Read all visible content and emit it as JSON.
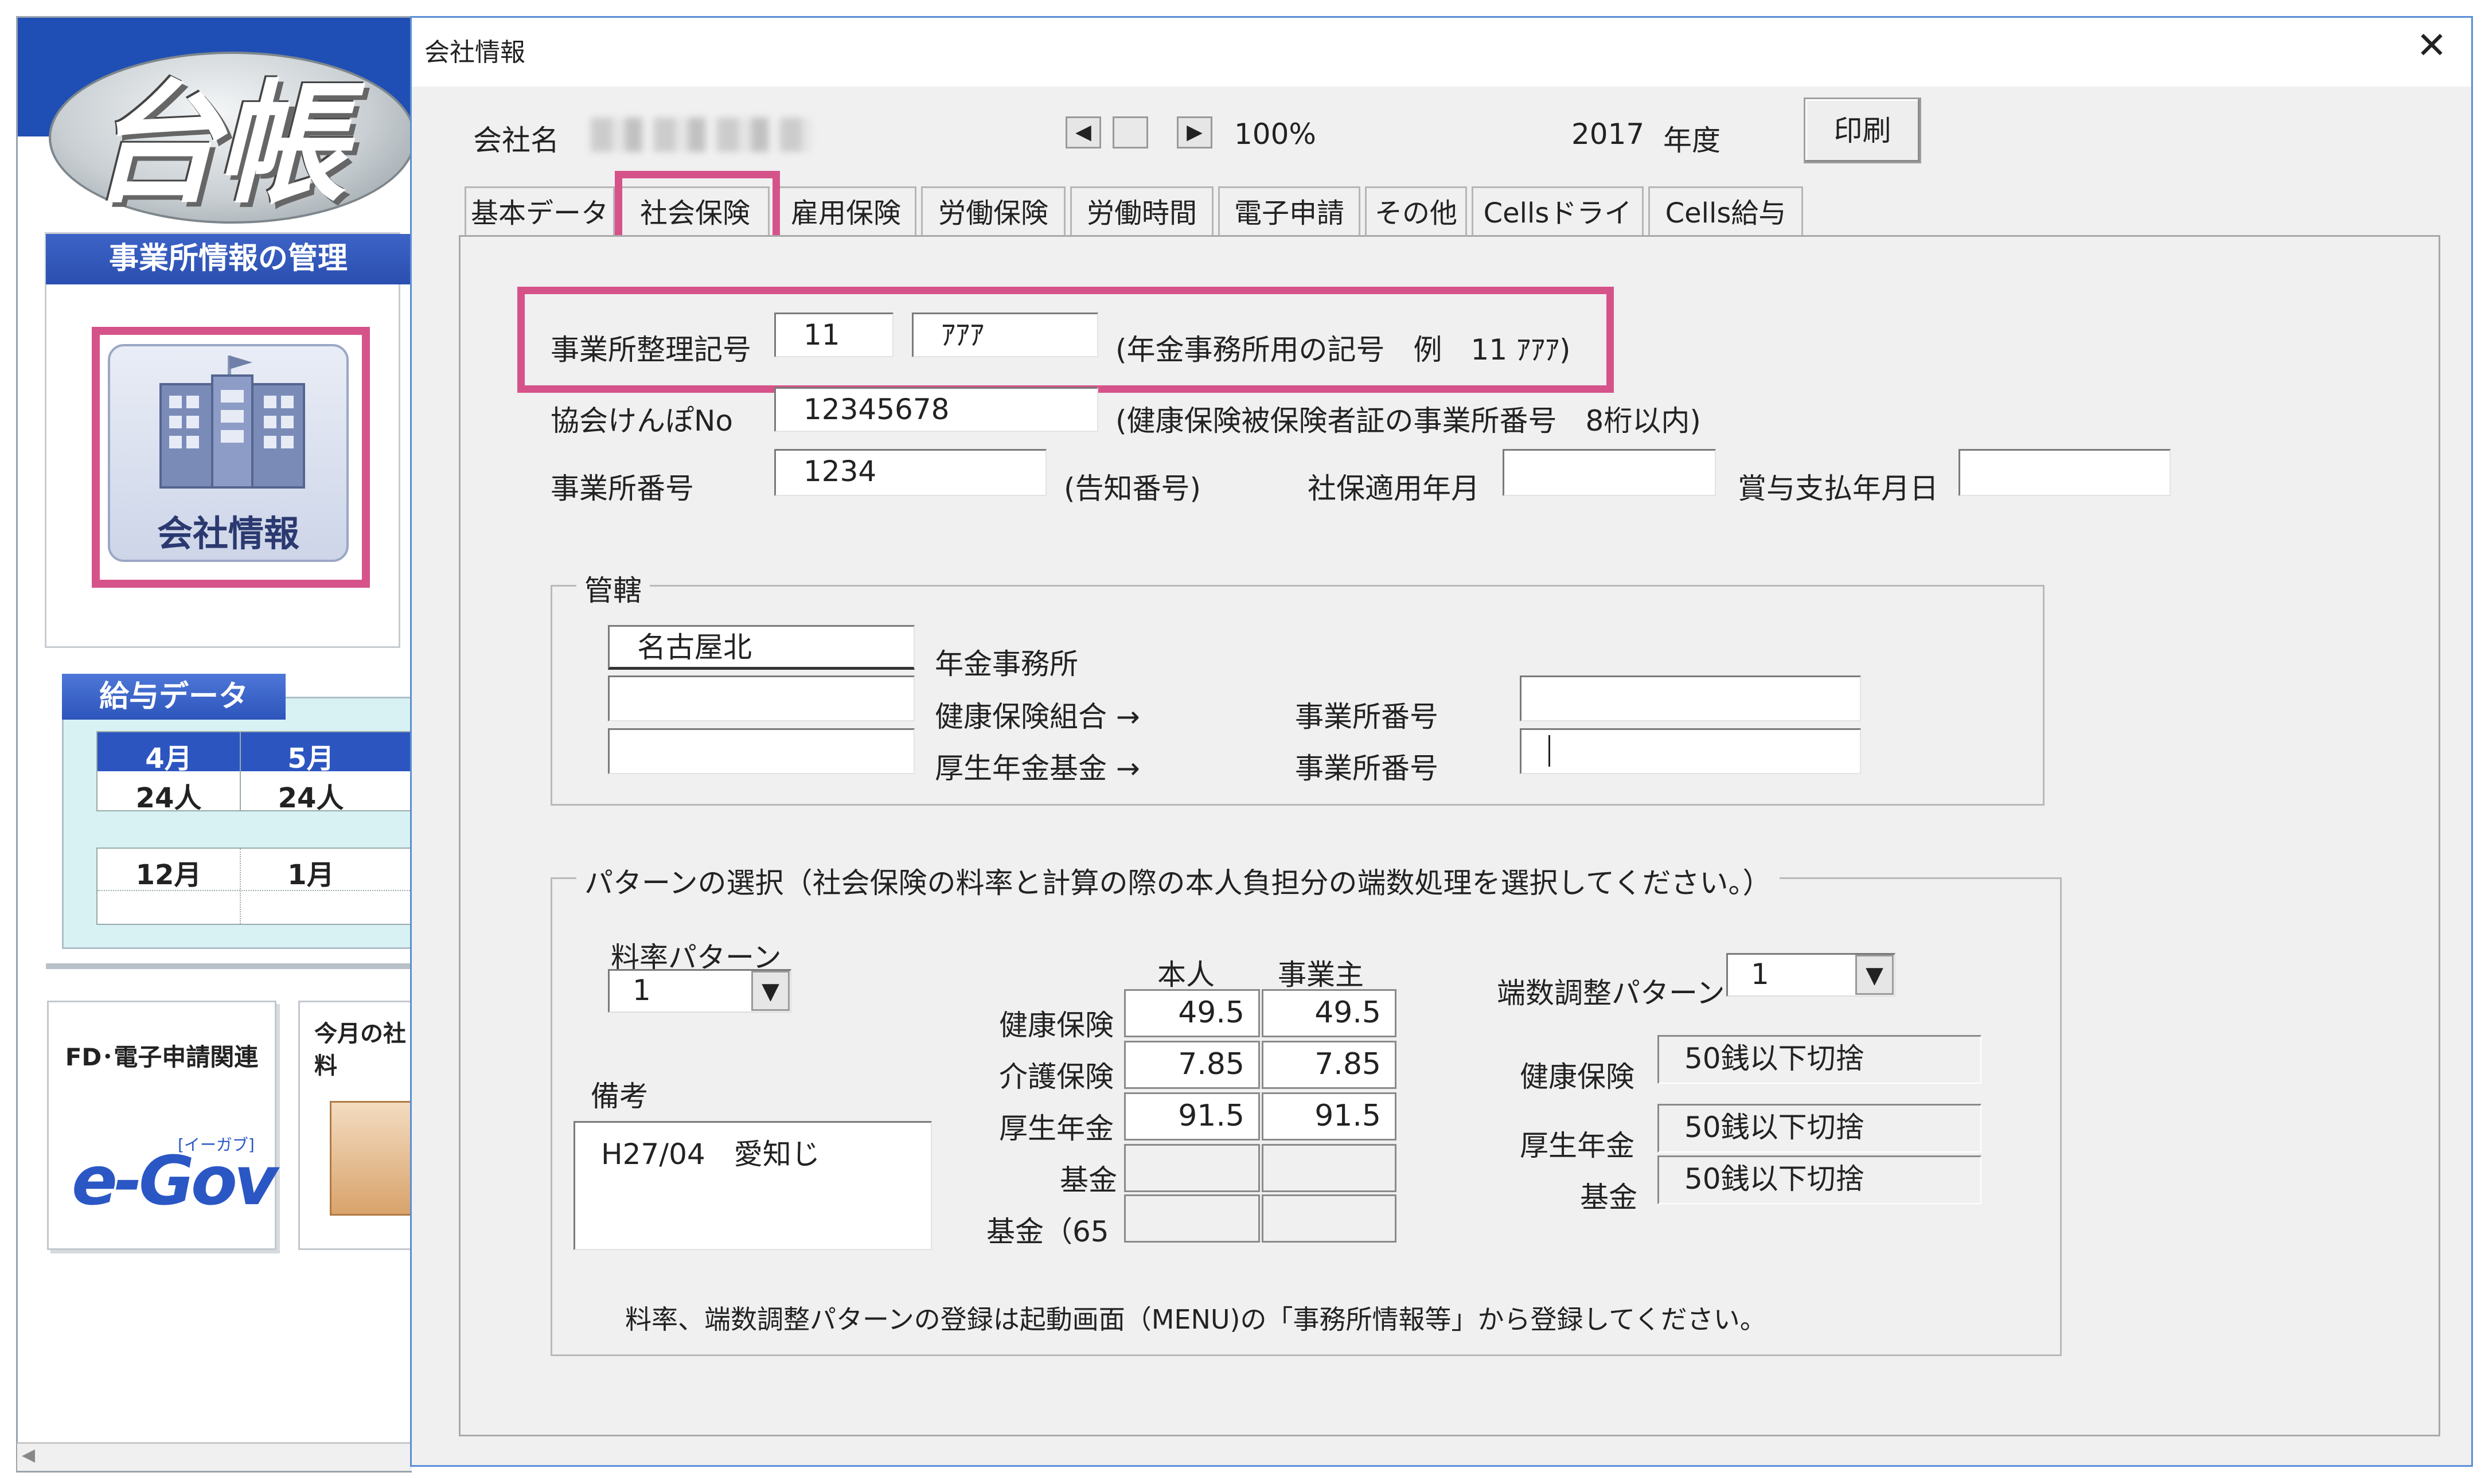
{
  "bg_app": {
    "logo_text": "台帳",
    "mgmt_section_title": "事業所情報の管理",
    "company_button_label": "会社情報",
    "salary_section_title": "給与データ",
    "months": [
      {
        "month": "4月",
        "count": "24人"
      },
      {
        "month": "5月",
        "count": "24人"
      },
      {
        "month": "12月",
        "count": ""
      },
      {
        "month": "1月",
        "count": ""
      }
    ],
    "fd_card_title": "FD･電子申請関連",
    "egov_logo": "e-Gov",
    "egov_sub": "[イーガブ]",
    "month_card_text": "今月の社\n料"
  },
  "dialog": {
    "title": "会社情報",
    "close_icon": "close-icon",
    "company_name_label": "会社名",
    "zoom": "100%",
    "year_value": "2017",
    "year_label": "年度",
    "print_button": "印刷",
    "tabs": [
      "基本データ",
      "社会保険",
      "雇用保険",
      "労働保険",
      "労働時間",
      "電子申請",
      "その他",
      "Cellsドライブ",
      "Cells給与"
    ],
    "active_tab": "社会保険"
  },
  "social": {
    "office_code_label": "事業所整理記号",
    "office_code_1": "11",
    "office_code_2": "ｱｱｱ",
    "office_code_note": "(年金事務所用の記号　例　11 ｱｱｱ)",
    "kyokai_label": "協会けんぽNo",
    "kyokai_value": "12345678",
    "kyokai_note": "(健康保険被保険者証の事業所番号　8桁以内)",
    "office_no_label": "事業所番号",
    "office_no_value": "1234",
    "office_no_note": "(告知番号)",
    "shaho_date_label": "社保適用年月",
    "shaho_date_value": "",
    "bonus_date_label": "賞与支払年月日",
    "bonus_date_value": ""
  },
  "jurisdiction": {
    "group_label": "管轄",
    "pension_office_value": "名古屋北",
    "pension_office_label": "年金事務所",
    "health_union_value": "",
    "health_union_label": "健康保険組合 →",
    "welfare_fund_value": "",
    "welfare_fund_label": "厚生年金基金 →",
    "office_no_label_1": "事業所番号",
    "office_no_value_1": "",
    "office_no_label_2": "事業所番号",
    "office_no_value_2": ""
  },
  "pattern": {
    "group_label": "パターンの選択（社会保険の料率と計算の際の本人負担分の端数処理を選択してください。）",
    "rate_pattern_label": "料率パターン",
    "rate_pattern_value": "1",
    "remarks_label": "備考",
    "remarks_value": "H27/04　愛知じ",
    "col_headers": [
      "本人",
      "事業主"
    ],
    "rows": [
      {
        "label": "健康保険",
        "self": "49.5",
        "employer": "49.5"
      },
      {
        "label": "介護保険",
        "self": "7.85",
        "employer": "7.85"
      },
      {
        "label": "厚生年金",
        "self": "91.5",
        "employer": "91.5"
      },
      {
        "label": "基金",
        "self": "",
        "employer": ""
      },
      {
        "label": "基金（65",
        "self": "",
        "employer": ""
      }
    ],
    "rounding_pattern_label": "端数調整パターン",
    "rounding_pattern_value": "1",
    "rounding": [
      {
        "label": "健康保険",
        "value": "50銭以下切捨"
      },
      {
        "label": "厚生年金",
        "value": "50銭以下切捨"
      },
      {
        "label": "基金",
        "value": "50銭以下切捨"
      }
    ],
    "footer_note": "料率、端数調整パターンの登録は起動画面（MENU)の「事務所情報等」から登録してください。"
  },
  "highlight_color": "#d6538a",
  "accent_blue": "#2a4fb0"
}
